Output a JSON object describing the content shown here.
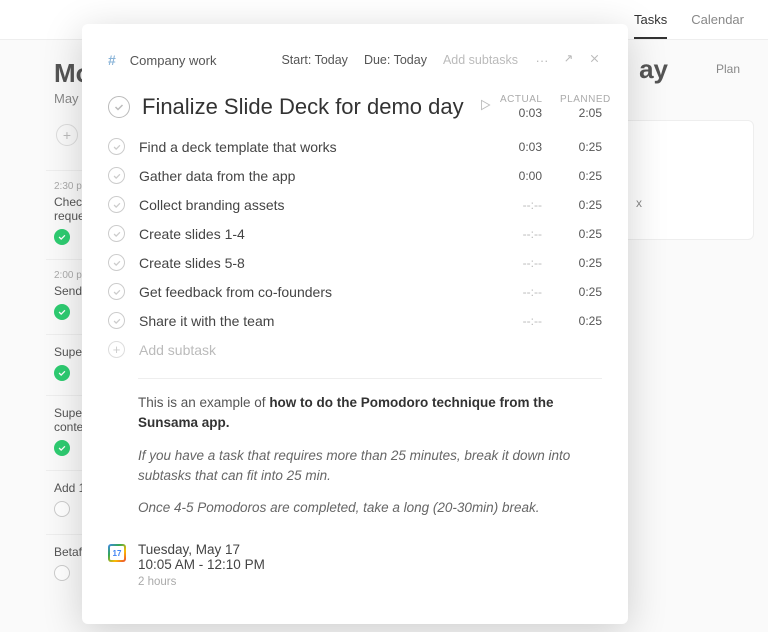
{
  "bg": {
    "nav": {
      "tasks": "Tasks",
      "calendar": "Calendar"
    },
    "title": "Mo",
    "date": "May 1",
    "plan": "Plan",
    "day": "ay",
    "x": "x",
    "tasks": [
      {
        "time": "2:30 p",
        "label": "Chec",
        "label2": "reque",
        "done": true
      },
      {
        "time": "2:00 p",
        "label": "Send",
        "label2": "",
        "done": true
      },
      {
        "time": "",
        "label": "Supe",
        "label2": "",
        "done": true
      },
      {
        "time": "",
        "label": "Supe",
        "label2": "conte",
        "done": true
      },
      {
        "time": "",
        "label": "Add 1",
        "label2": "",
        "done": false
      },
      {
        "time": "",
        "label": "Betaf",
        "label2": "",
        "done": false
      }
    ]
  },
  "modal": {
    "hash": "#",
    "category": "Company work",
    "start": "Start: Today",
    "due": "Due: Today",
    "add_subtasks": "Add subtasks",
    "title": "Finalize Slide Deck for demo day",
    "actual_label": "ACTUAL",
    "planned_label": "PLANNED",
    "actual_total": "0:03",
    "planned_total": "2:05",
    "subtasks": [
      {
        "name": "Find a deck template that works",
        "actual": "0:03",
        "planned": "0:25"
      },
      {
        "name": "Gather data from the app",
        "actual": "0:00",
        "planned": "0:25"
      },
      {
        "name": "Collect branding assets",
        "actual": "--:--",
        "planned": "0:25"
      },
      {
        "name": "Create slides 1-4",
        "actual": "--:--",
        "planned": "0:25"
      },
      {
        "name": "Create slides 5-8",
        "actual": "--:--",
        "planned": "0:25"
      },
      {
        "name": "Get feedback from co-founders",
        "actual": "--:--",
        "planned": "0:25"
      },
      {
        "name": "Share it with the team",
        "actual": "--:--",
        "planned": "0:25"
      }
    ],
    "add_subtask": "Add subtask",
    "notes": {
      "intro_a": "This is an example of ",
      "intro_b": "how to do the Pomodoro technique from the Sunsama app.",
      "line2": "If you have a task that requires more than 25 minutes, break it down into subtasks that can fit into 25 min.",
      "line3": "Once 4-5 Pomodoros are completed, take a long (20-30min) break."
    },
    "schedule": {
      "day": "Tuesday, May 17",
      "time": "10:05 AM - 12:10 PM",
      "duration": "2 hours",
      "cal_num": "17"
    }
  }
}
